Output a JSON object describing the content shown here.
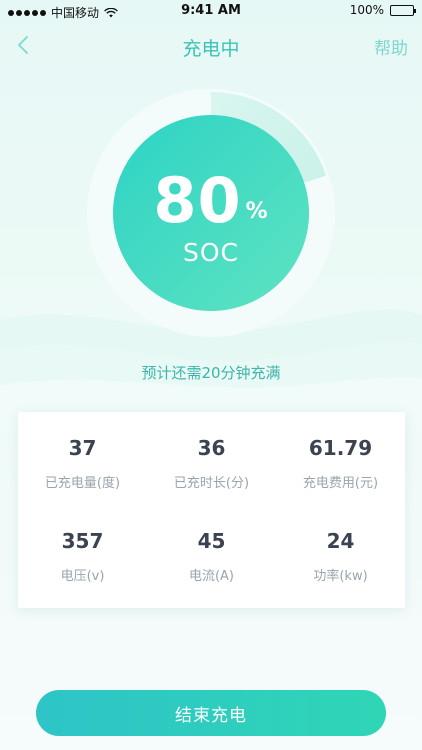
{
  "status_bar": {
    "carrier": "中国移动",
    "time": "9:41 AM",
    "battery": "100%"
  },
  "nav": {
    "title": "充电中",
    "help": "帮助",
    "back_icon": "chevron-left-icon"
  },
  "gauge": {
    "soc_value": "80",
    "soc_unit": "%",
    "soc_label": "SOC",
    "progress_fraction": 0.8
  },
  "estimate_text": "预计还需20分钟充满",
  "stats": [
    {
      "value": "37",
      "label": "已充电量(度)"
    },
    {
      "value": "36",
      "label": "已充时长(分)"
    },
    {
      "value": "61.79",
      "label": "充电费用(元)"
    },
    {
      "value": "357",
      "label": "电压(v)"
    },
    {
      "value": "45",
      "label": "电流(A)"
    },
    {
      "value": "24",
      "label": "功率(kw)"
    }
  ],
  "end_button": "结束充电",
  "colors": {
    "accent": "#3cc2b6",
    "gauge_fill_start": "#2dd3c4",
    "gauge_fill_end": "#5fe3c2",
    "button_start": "#2ec4c8",
    "button_end": "#2fd6b5"
  }
}
